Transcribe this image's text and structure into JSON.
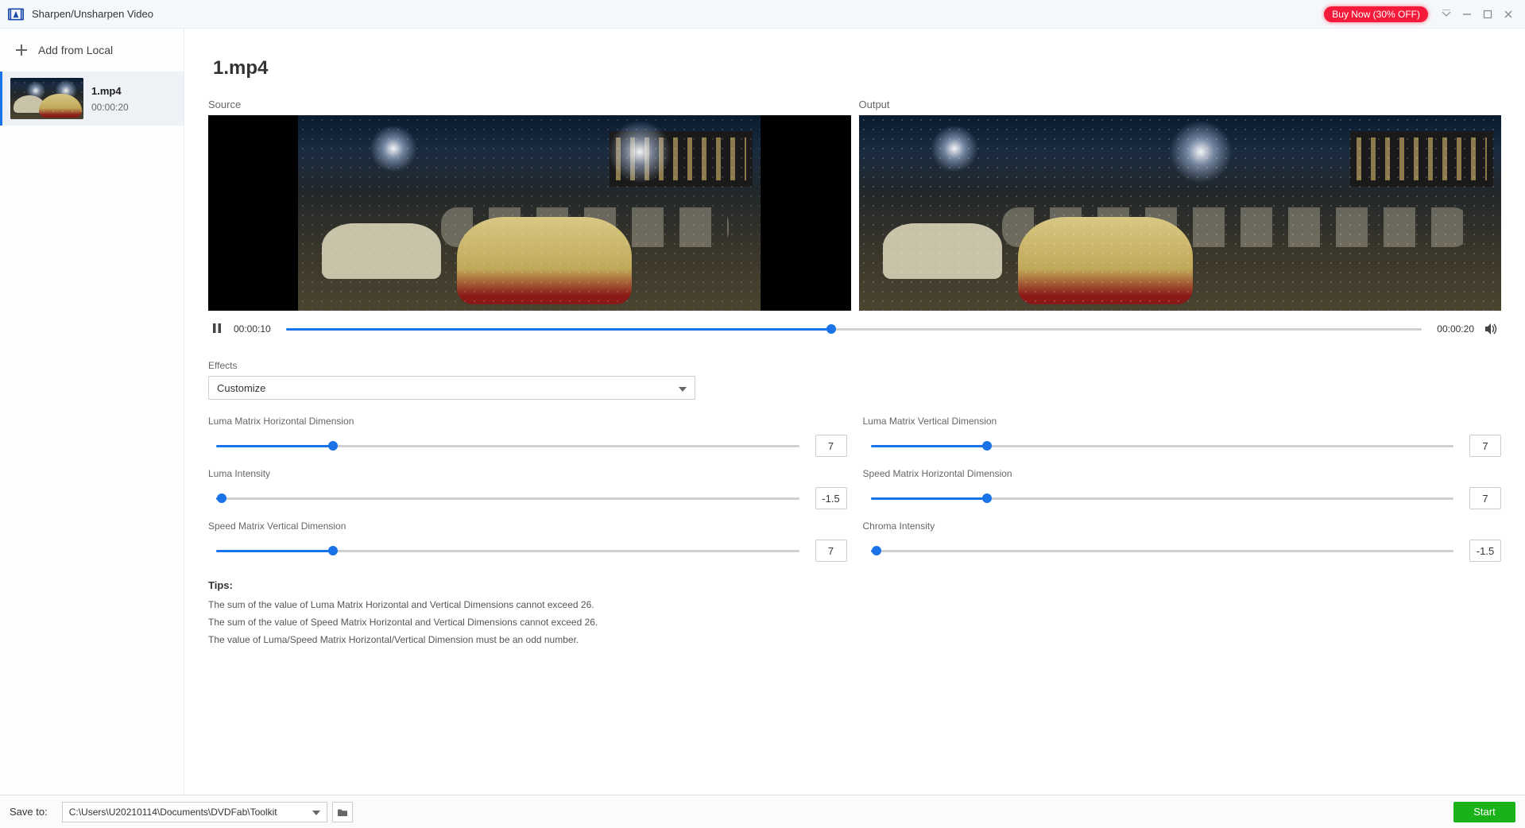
{
  "titlebar": {
    "title": "Sharpen/Unsharpen Video",
    "buy_now": "Buy Now (30% OFF)"
  },
  "sidebar": {
    "add_label": "Add from Local",
    "items": [
      {
        "name": "1.mp4",
        "duration": "00:00:20"
      }
    ]
  },
  "main": {
    "file_title": "1.mp4",
    "source_label": "Source",
    "output_label": "Output",
    "playback": {
      "current": "00:00:10",
      "total": "00:00:20",
      "progress_pct": 48
    },
    "effects_label": "Effects",
    "effects_selected": "Customize",
    "sliders": {
      "luma_h": {
        "label": "Luma Matrix Horizontal Dimension",
        "value": "7",
        "pct": 20
      },
      "luma_v": {
        "label": "Luma Matrix Vertical Dimension",
        "value": "7",
        "pct": 20
      },
      "luma_i": {
        "label": "Luma Intensity",
        "value": "-1.5",
        "pct": 1
      },
      "speed_h": {
        "label": "Speed Matrix Horizontal Dimension",
        "value": "7",
        "pct": 20
      },
      "speed_v": {
        "label": "Speed Matrix Vertical Dimension",
        "value": "7",
        "pct": 20
      },
      "chroma_i": {
        "label": "Chroma Intensity",
        "value": "-1.5",
        "pct": 1
      }
    },
    "tips": {
      "title": "Tips:",
      "lines": [
        "The sum of the value of Luma Matrix Horizontal and Vertical Dimensions cannot exceed 26.",
        "The sum of the value of Speed Matrix Horizontal and Vertical Dimensions cannot exceed 26.",
        "The value of Luma/Speed Matrix Horizontal/Vertical Dimension must be an odd number."
      ]
    }
  },
  "footer": {
    "save_to_label": "Save to:",
    "path": "C:\\Users\\U20210114\\Documents\\DVDFab\\Toolkit",
    "start_label": "Start"
  }
}
